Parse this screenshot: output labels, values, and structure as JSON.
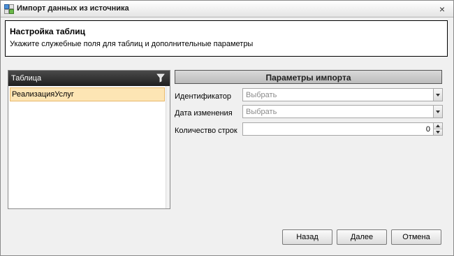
{
  "window": {
    "title": "Импорт данных из источника",
    "close_label": "×",
    "icon": "data-import-icon"
  },
  "header": {
    "title": "Настройка таблиц",
    "subtitle": "Укажите служебные поля для таблиц и дополнительные параметры"
  },
  "tables": {
    "column_header": "Таблица",
    "filter_icon": "filter-icon",
    "rows": [
      {
        "name": "РеализацияУслуг",
        "selected": true
      }
    ]
  },
  "params": {
    "title": "Параметры импорта",
    "identifier_label": "Идентификатор",
    "identifier_value": "Выбрать",
    "modified_label": "Дата изменения",
    "modified_value": "Выбрать",
    "row_count_label": "Количество строк",
    "row_count_value": "0"
  },
  "buttons": {
    "back": "Назад",
    "next": "Далее",
    "cancel": "Отмена"
  },
  "colors": {
    "selected_row": "#fde5b4",
    "header_dark": "#2a2a2a"
  }
}
